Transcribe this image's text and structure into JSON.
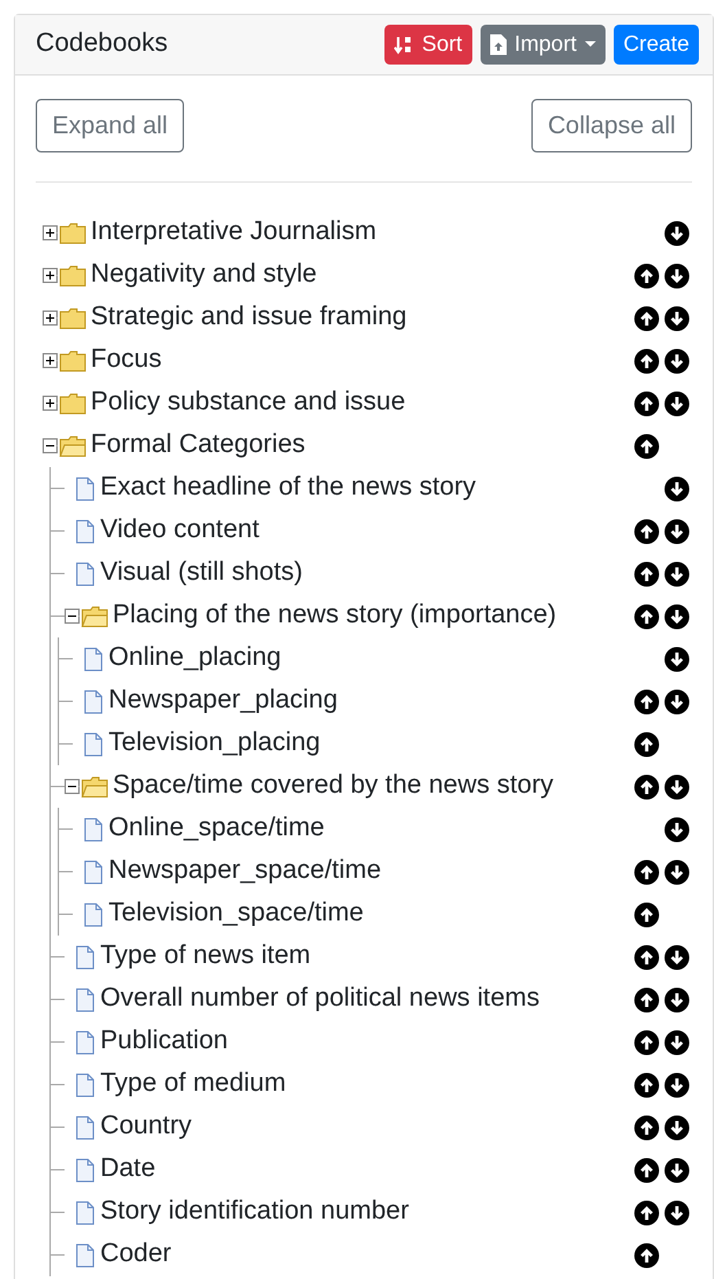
{
  "header": {
    "title": "Codebooks",
    "buttons": [
      {
        "label": "Sort",
        "kind": "sort"
      },
      {
        "label": "Import",
        "kind": "import"
      },
      {
        "label": "Create",
        "kind": "create"
      }
    ]
  },
  "actions": {
    "expand": "Expand all",
    "collapse": "Collapse all"
  },
  "tree": [
    {
      "label": "Interpretative Journalism",
      "kind": "folder",
      "expanded": false,
      "up": false,
      "down": true
    },
    {
      "label": "Negativity and style",
      "kind": "folder",
      "expanded": false,
      "up": true,
      "down": true
    },
    {
      "label": "Strategic and issue framing",
      "kind": "folder",
      "expanded": false,
      "up": true,
      "down": true
    },
    {
      "label": "Focus",
      "kind": "folder",
      "expanded": false,
      "up": true,
      "down": true
    },
    {
      "label": "Policy substance and issue",
      "kind": "folder",
      "expanded": false,
      "up": true,
      "down": true
    },
    {
      "label": "Formal Categories",
      "kind": "folder",
      "expanded": true,
      "up": true,
      "down": false,
      "children": [
        {
          "label": "Exact headline of the news story",
          "kind": "file",
          "up": false,
          "down": true
        },
        {
          "label": "Video content",
          "kind": "file",
          "up": true,
          "down": true
        },
        {
          "label": "Visual (still shots)",
          "kind": "file",
          "up": true,
          "down": true
        },
        {
          "label": "Placing of the news story (importance)",
          "kind": "folder",
          "expanded": true,
          "up": true,
          "down": true,
          "children": [
            {
              "label": "Online_placing",
              "kind": "file",
              "up": false,
              "down": true
            },
            {
              "label": "Newspaper_placing",
              "kind": "file",
              "up": true,
              "down": true
            },
            {
              "label": "Television_placing",
              "kind": "file",
              "up": true,
              "down": false
            }
          ]
        },
        {
          "label": "Space/time covered by the news story",
          "kind": "folder",
          "expanded": true,
          "up": true,
          "down": true,
          "children": [
            {
              "label": "Online_space/time",
              "kind": "file",
              "up": false,
              "down": true
            },
            {
              "label": "Newspaper_space/time",
              "kind": "file",
              "up": true,
              "down": true
            },
            {
              "label": "Television_space/time",
              "kind": "file",
              "up": true,
              "down": false
            }
          ]
        },
        {
          "label": "Type of news item",
          "kind": "file",
          "up": true,
          "down": true
        },
        {
          "label": "Overall number of political news items",
          "kind": "file",
          "up": true,
          "down": true
        },
        {
          "label": "Publication",
          "kind": "file",
          "up": true,
          "down": true
        },
        {
          "label": "Type of medium",
          "kind": "file",
          "up": true,
          "down": true
        },
        {
          "label": "Country",
          "kind": "file",
          "up": true,
          "down": true
        },
        {
          "label": "Date",
          "kind": "file",
          "up": true,
          "down": true
        },
        {
          "label": "Story identification number",
          "kind": "file",
          "up": true,
          "down": true
        },
        {
          "label": "Coder",
          "kind": "file",
          "up": true,
          "down": false
        }
      ]
    }
  ]
}
